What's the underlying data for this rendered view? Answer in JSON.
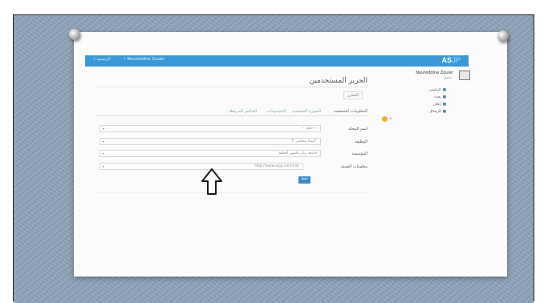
{
  "topbar": {
    "brand_main": "AS",
    "brand_accent": "JP",
    "menu_label": "• الرئيسية",
    "user_label": "• Noureddine Zouler",
    "color": "#3a9ad9"
  },
  "sidebar": {
    "user_name": "Noureddine Zouler",
    "user_status": "متصل",
    "items": [
      {
        "label": "الرئيسي",
        "icon": "home-icon"
      },
      {
        "label": "بحث",
        "icon": "search-icon"
      },
      {
        "label": "إعلان",
        "icon": "bell-icon"
      },
      {
        "label": "الرسائل",
        "icon": "mail-icon"
      }
    ]
  },
  "main": {
    "title": "الحرير المستخدمين",
    "tag": "المحرر",
    "tabs": [
      "المعلومات الشخصية",
      "الصورة الشخصية",
      "المجموعات",
      "العناصر المرتبطة"
    ],
    "fields": [
      {
        "label": "اسم المجلة",
        "value": "-- حافل --"
      },
      {
        "label": "الوظيفة",
        "value": "أستاذ محاضر \"أ\""
      },
      {
        "label": "المؤسسة",
        "value": "جامعة زيان عاشور الجلفة"
      },
      {
        "label": "معلومات الضيف",
        "value": "http://www.asjp.cerist.dz"
      }
    ],
    "submit_label": "حفظ"
  }
}
